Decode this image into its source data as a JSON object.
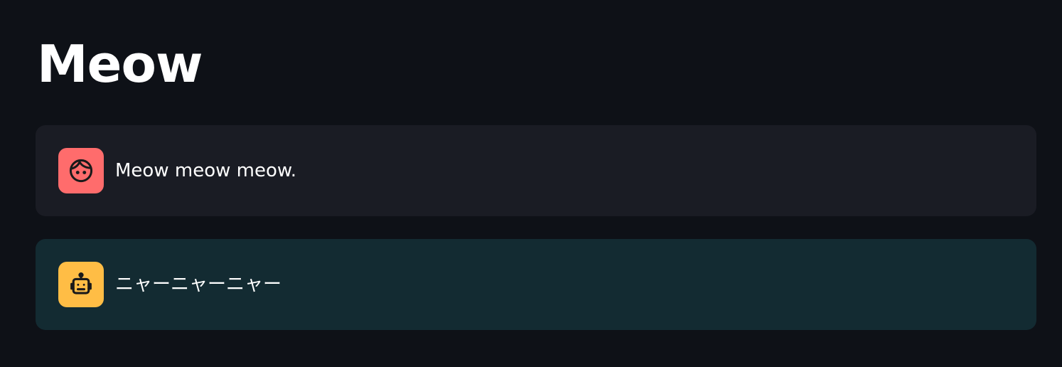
{
  "page": {
    "title": "Meow"
  },
  "messages": [
    {
      "role": "user",
      "icon": "face-icon",
      "avatar_color": "#ff6c6c",
      "text": "Meow meow meow."
    },
    {
      "role": "assistant",
      "icon": "robot-icon",
      "avatar_color": "#ffbd45",
      "text": "ニャーニャーニャー"
    }
  ],
  "colors": {
    "background": "#0e1117",
    "user_bubble": "#1a1c24",
    "assistant_bubble": "#132b32",
    "text": "#fafafa"
  }
}
